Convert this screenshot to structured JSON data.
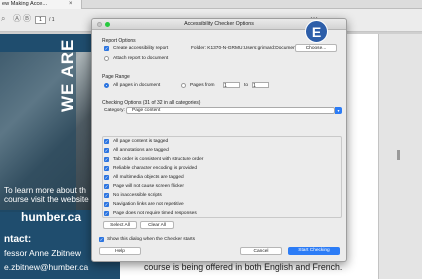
{
  "tab": {
    "title": "ew Making Acce...",
    "close": "×"
  },
  "toolbar": {
    "page_number": "1",
    "page_total": "/ 1"
  },
  "promo": {
    "vertical": "WE ARE",
    "line1": "To learn more about th",
    "line2": "course visit the website",
    "site": "humber.ca",
    "contact": "ntact:",
    "name": "fessor Anne Zbitnew",
    "email": "e.zbitnew@humber.ca"
  },
  "footer_text": "course is being offered in both English and French.",
  "badge": "E",
  "dialog": {
    "title": "Accessibility Checker Options",
    "report": {
      "section_label": "Report Options",
      "create_label": "Create accessibility report",
      "folder_label": "Folder: K1370-N-GRMU:Users:grimard:Documents:",
      "choose_label": "Choose...",
      "attach_label": "Attach report to document"
    },
    "range": {
      "section_label": "Page Range",
      "all_pages_label": "All pages in document",
      "pages_from_label": "Pages from",
      "from_value": "1",
      "to_label": "to",
      "to_value": "1"
    },
    "checking": {
      "section_label": "Checking Options (31 of 32 in all categories)",
      "category_label": "Category:",
      "category_value": "Page content",
      "items": [
        "All page content is tagged",
        "All annotations are tagged",
        "Tab order is consistent with structure order",
        "Reliable character encoding is provided",
        "All multimedia objects are tagged",
        "Page will not cause screen flicker",
        "No inaccessible scripts",
        "Navigation links are not repetitive",
        "Page does not require timed responses"
      ],
      "select_all_label": "Select All",
      "clear_all_label": "Clear All"
    },
    "show_dialog_label": "Show this dialog when the Checker starts",
    "help_label": "Help",
    "cancel_label": "Cancel",
    "start_label": "Start Checking"
  },
  "colors": {
    "accent": "#2c7cf6",
    "badge": "#2d5ea9",
    "panel": "#1f4d6e"
  }
}
